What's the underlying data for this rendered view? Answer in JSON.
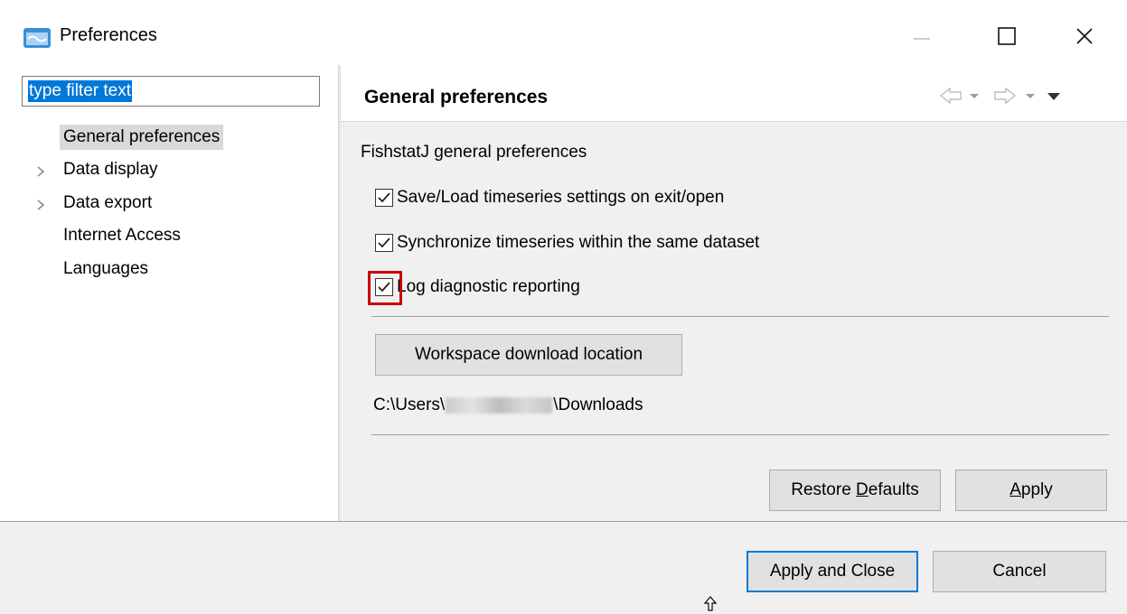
{
  "window": {
    "title": "Preferences",
    "app_icon": "preferences-app-icon",
    "controls": [
      "minimize-icon",
      "maximize-icon",
      "close-icon"
    ]
  },
  "filter": {
    "text": "type filter text"
  },
  "tree": {
    "items": [
      {
        "label": "General preferences",
        "selected": true,
        "expandable": false
      },
      {
        "label": "Data display",
        "selected": false,
        "expandable": true
      },
      {
        "label": "Data export",
        "selected": false,
        "expandable": true
      },
      {
        "label": "Internet Access",
        "selected": false,
        "expandable": false
      },
      {
        "label": "Languages",
        "selected": false,
        "expandable": false
      }
    ]
  },
  "page": {
    "title": "General preferences",
    "section_label": "FishstatJ general preferences",
    "options": [
      {
        "label": "Save/Load timeseries settings on exit/open",
        "checked": true
      },
      {
        "label": "Synchronize timeseries within the same dataset",
        "checked": true
      },
      {
        "label": "Log diagnostic reporting",
        "checked": true,
        "highlighted": true
      }
    ],
    "workspace_button": "Workspace download location",
    "path_prefix": "C:\\Users\\",
    "path_suffix": "\\Downloads",
    "restore_defaults_prefix": "Restore ",
    "restore_defaults_mnemonic": "D",
    "restore_defaults_suffix": "efaults",
    "apply_mnemonic": "A",
    "apply_suffix": "pply"
  },
  "footer": {
    "apply_close": "Apply and Close",
    "cancel": "Cancel"
  },
  "colors": {
    "selection": "#0078d7",
    "highlight_frame": "#cc0000",
    "panel_bg": "#f0f0f0"
  }
}
